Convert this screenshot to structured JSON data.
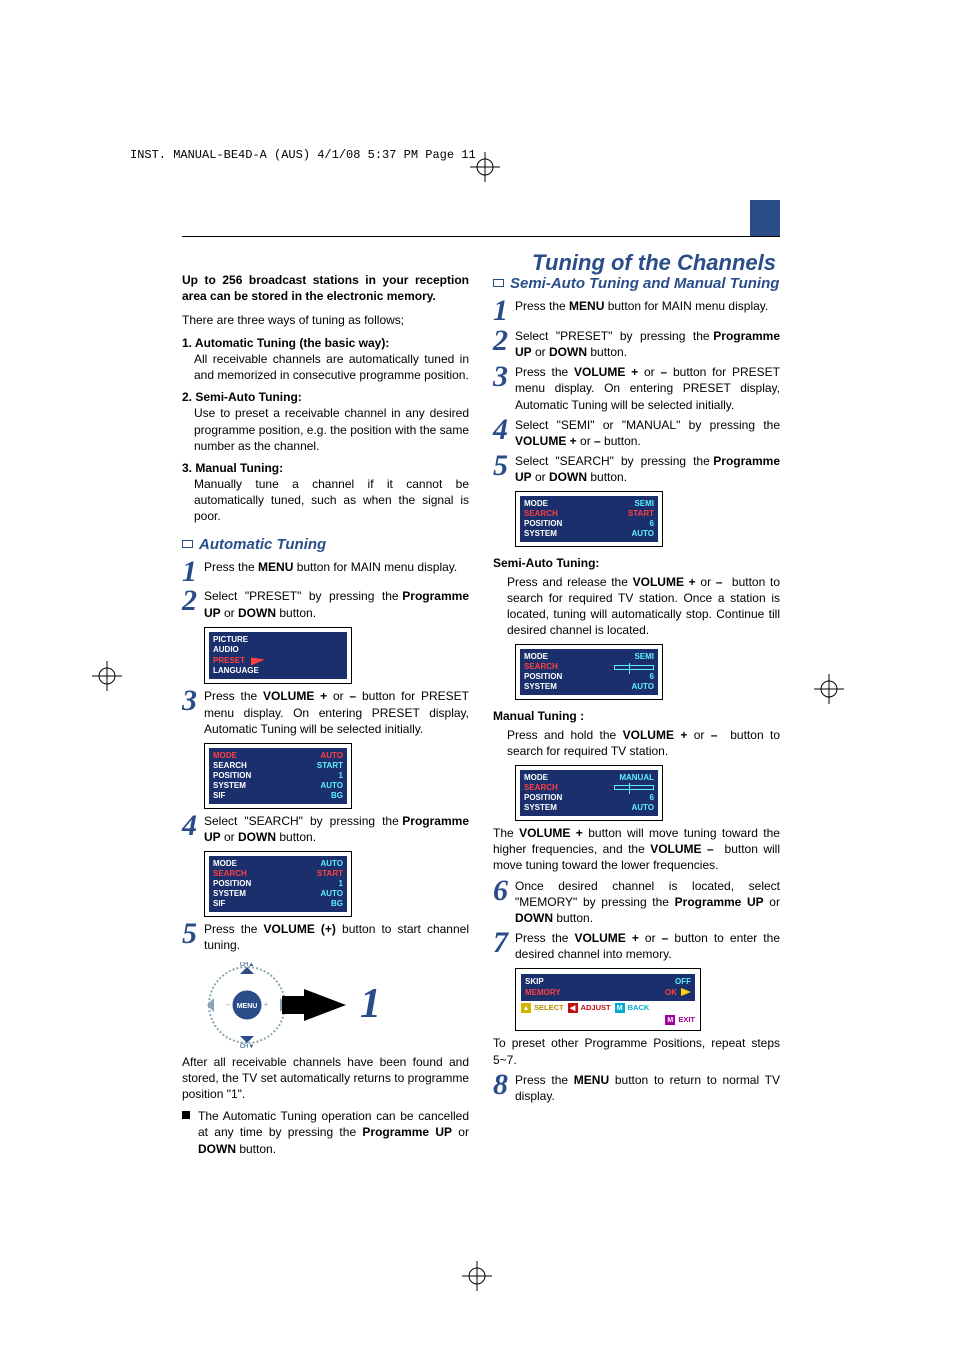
{
  "meta": {
    "header_line": "INST. MANUAL-BE4D-A (AUS)  4/1/08  5:37 PM  Page 11"
  },
  "title": "Tuning of the Channels",
  "left": {
    "intro_bold": "Up to 256 broadcast stations in your reception area can be stored in the electronic memory.",
    "intro_para": "There are three ways of tuning as follows;",
    "types": {
      "t1_head": "1. Automatic Tuning (the basic way):",
      "t1_body": "All receivable channels are automatically tuned in and memorized in consecutive programme position.",
      "t2_head": "2. Semi-Auto Tuning:",
      "t2_body": "Use to preset a receivable channel in any desired programme position, e.g. the position with the same number as the channel.",
      "t3_head": "3. Manual Tuning:",
      "t3_body": "Manually tune a channel if it cannot be automatically tuned, such as when the signal is poor."
    },
    "section_auto": "Automatic Tuning",
    "steps": {
      "s1": "Press the MENU button for MAIN menu display.",
      "s2": "Select \"PRESET\" by pressing the Programme UP or DOWN button.",
      "s3": "Press the VOLUME + or – button for PRESET menu display. On entering PRESET display, Automatic Tuning will be selected initially.",
      "s4": "Select \"SEARCH\" by pressing the Programme UP or DOWN button.",
      "s5": "Press the VOLUME (+) button to start channel tuning."
    },
    "after_para": "After all receivable channels have been found and stored, the TV set automatically returns to programme position \"1\".",
    "cancel_para": "The Automatic Tuning operation can be cancelled at any time by pressing the Programme UP or DOWN button.",
    "big1": "1"
  },
  "right": {
    "section_semi": "Semi-Auto Tuning and Manual Tuning",
    "steps": {
      "s1": "Press the MENU button for MAIN menu display.",
      "s2": "Select \"PRESET\" by pressing the Programme UP or DOWN button.",
      "s3": "Press the VOLUME + or – button for PRESET menu display. On entering PRESET display, Automatic Tuning will be selected initially.",
      "s4": "Select \"SEMI\" or \"MANUAL\" by pressing the VOLUME + or – button.",
      "s5": "Select \"SEARCH\" by pressing the Programme UP or DOWN button.",
      "s6": "Once desired channel is located, select \"MEMORY\" by pressing the Programme UP or DOWN button.",
      "s7": "Press the VOLUME + or – button to enter the desired channel into memory.",
      "s8": "Press the MENU button to return to normal TV display."
    },
    "semi_head": "Semi-Auto Tuning:",
    "semi_body": "Press and release the VOLUME + or –  button to search for required TV station. Once a station is located, tuning will automatically stop. Continue till desired channel is located.",
    "manual_head": "Manual Tuning :",
    "manual_body": "Press and hold the VOLUME + or –  button to search for required TV station.",
    "freq_para": "The VOLUME + button will move tuning toward the higher frequencies, and the VOLUME –  button will move tuning toward the lower frequencies.",
    "repeat_para": "To preset other Programme Positions, repeat steps 5~7."
  },
  "osd": {
    "main_menu": [
      "PICTURE",
      "AUDIO",
      "PRESET",
      "LANGUAGE"
    ],
    "auto1": {
      "MODE": "AUTO",
      "SEARCH": "START",
      "POSITION": "1",
      "SYSTEM": "AUTO",
      "SIF": "BG"
    },
    "auto2": {
      "MODE": "AUTO",
      "SEARCH": "START",
      "POSITION": "1",
      "SYSTEM": "AUTO",
      "SIF": "BG"
    },
    "semi1": {
      "MODE": "SEMI",
      "SEARCH": "START",
      "POSITION": "6",
      "SYSTEM": "AUTO"
    },
    "semi2": {
      "MODE": "SEMI",
      "SEARCH": "(bar)",
      "POSITION": "6",
      "SYSTEM": "AUTO"
    },
    "manual": {
      "MODE": "MANUAL",
      "SEARCH": "(bar)",
      "POSITION": "6",
      "SYSTEM": "AUTO"
    },
    "skip": {
      "SKIP": "OFF",
      "MEMORY": "OK"
    },
    "softkeys": {
      "select": "SELECT",
      "adjust": "ADJUST",
      "back": "BACK",
      "exit": "EXIT"
    }
  },
  "remote": {
    "menu": "MENU",
    "ch_up": "CH▲",
    "ch_down": "CH▼"
  }
}
